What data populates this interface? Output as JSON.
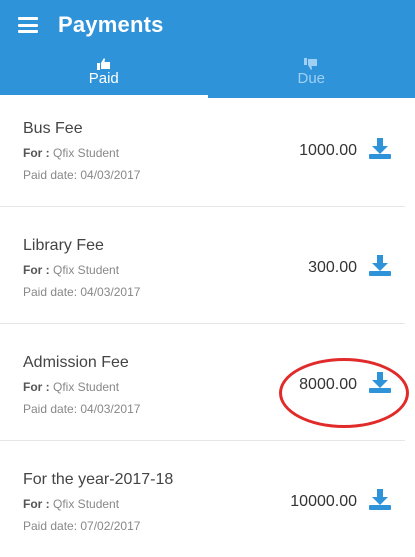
{
  "appbar": {
    "title": "Payments"
  },
  "tabs": [
    {
      "label": "Paid",
      "icon": "thumbs-up-icon"
    },
    {
      "label": "Due",
      "icon": "thumbs-down-icon"
    }
  ],
  "payments": [
    {
      "name": "Bus Fee",
      "for_label": "For :",
      "for_value": "Qfix Student",
      "paid_date": "Paid date: 04/03/2017",
      "amount": "1000.00"
    },
    {
      "name": "Library Fee",
      "for_label": "For :",
      "for_value": "Qfix Student",
      "paid_date": "Paid date: 04/03/2017",
      "amount": "300.00"
    },
    {
      "name": "Admission Fee",
      "for_label": "For :",
      "for_value": "Qfix Student",
      "paid_date": "Paid date: 04/03/2017",
      "amount": "8000.00"
    },
    {
      "name": "For the year-2017-18",
      "for_label": "For :",
      "for_value": "Qfix Student",
      "paid_date": "Paid date: 07/02/2017",
      "amount": "10000.00"
    }
  ],
  "colors": {
    "primary": "#2e93d9",
    "highlight": "#e12a2a"
  }
}
